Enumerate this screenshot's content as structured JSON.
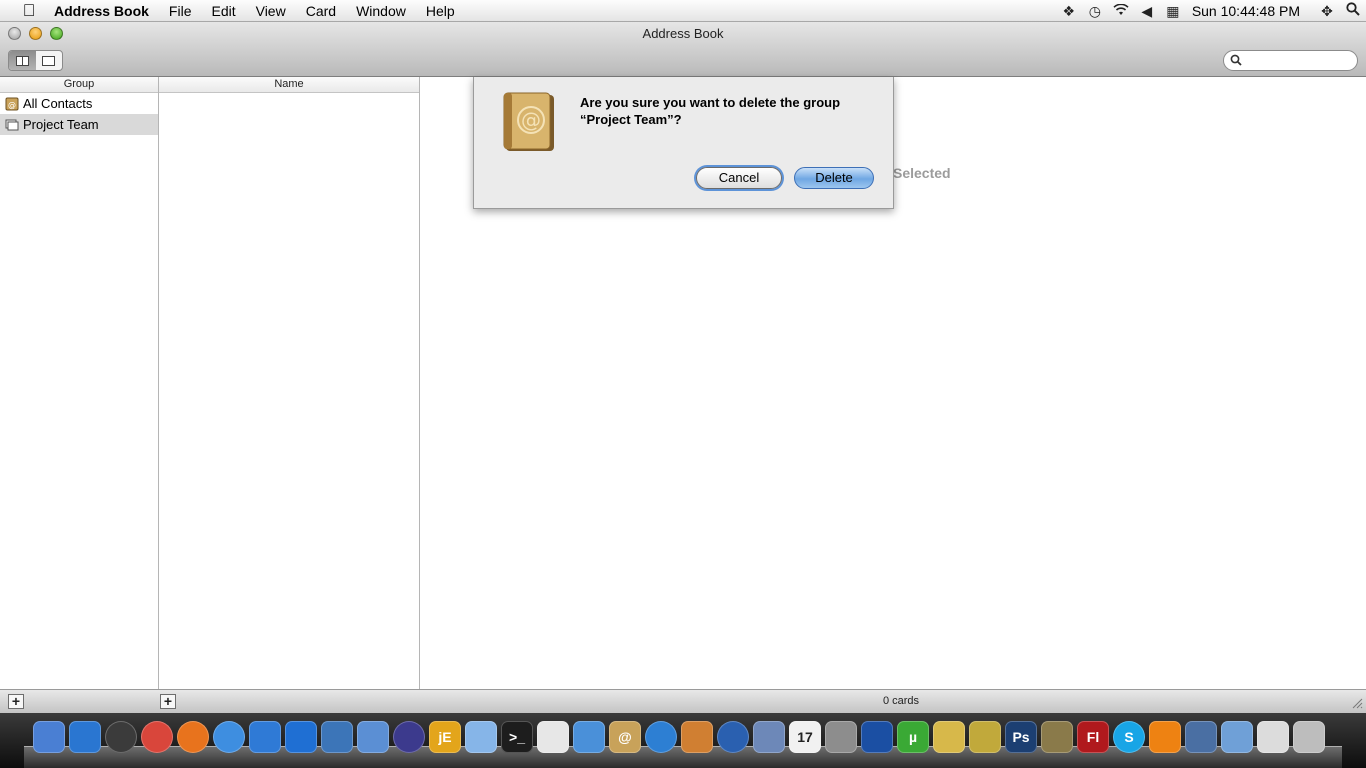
{
  "menubar": {
    "app_name": "Address Book",
    "menus": [
      "File",
      "Edit",
      "View",
      "Card",
      "Window",
      "Help"
    ],
    "clock": "Sun 10:44:48 PM"
  },
  "window": {
    "title": "Address Book"
  },
  "search": {
    "placeholder": ""
  },
  "columns": {
    "group_header": "Group",
    "name_header": "Name"
  },
  "groups": [
    {
      "label": "All Contacts",
      "selected": false
    },
    {
      "label": "Project Team",
      "selected": true
    }
  ],
  "card_area": {
    "empty_text": "Selected"
  },
  "status_bar": {
    "card_count": "0 cards"
  },
  "dialog": {
    "message_line1": "Are you sure you want to delete the group",
    "message_line2": "“Project Team”?",
    "cancel_label": "Cancel",
    "delete_label": "Delete"
  },
  "dock": {
    "items": [
      {
        "name": "finder",
        "color": "#4a7fd3"
      },
      {
        "name": "app-store",
        "color": "#2a76d1"
      },
      {
        "name": "dashboard",
        "color": "#3b3b3b"
      },
      {
        "name": "chrome",
        "color": "#d9463b"
      },
      {
        "name": "firefox",
        "color": "#e8731d"
      },
      {
        "name": "safari",
        "color": "#3e8ee0"
      },
      {
        "name": "ichat",
        "color": "#2f7ad6"
      },
      {
        "name": "internet-explorer",
        "color": "#1f6fd3"
      },
      {
        "name": "xcode",
        "color": "#3c75b8"
      },
      {
        "name": "preview",
        "color": "#5b8fd4"
      },
      {
        "name": "eclipse",
        "color": "#3c3a8d"
      },
      {
        "name": "jedit",
        "color": "#e3a51b",
        "text": "jE"
      },
      {
        "name": "mail",
        "color": "#86b5e8"
      },
      {
        "name": "terminal",
        "color": "#1d1d1d",
        "text": ">_"
      },
      {
        "name": "textedit",
        "color": "#e7e7e7"
      },
      {
        "name": "facetime",
        "color": "#4a90d9"
      },
      {
        "name": "address-book",
        "color": "#c8a25a",
        "text": "@"
      },
      {
        "name": "itunes",
        "color": "#2d7fd3"
      },
      {
        "name": "iphoto",
        "color": "#d07f32"
      },
      {
        "name": "dvd-player",
        "color": "#2a60b0"
      },
      {
        "name": "mail-stamp",
        "color": "#6d88b8"
      },
      {
        "name": "ical",
        "color": "#f1f1f1",
        "text": "17"
      },
      {
        "name": "system-preferences",
        "color": "#8d8d8d"
      },
      {
        "name": "frog-app",
        "color": "#1b4fa3"
      },
      {
        "name": "utorrent",
        "color": "#3aa935",
        "text": "µ"
      },
      {
        "name": "pencil-app",
        "color": "#d7b84a"
      },
      {
        "name": "flight-app",
        "color": "#c1a93b"
      },
      {
        "name": "photoshop",
        "color": "#1c3f72",
        "text": "Ps"
      },
      {
        "name": "paris-app",
        "color": "#8a7a4a"
      },
      {
        "name": "flash",
        "color": "#b0191d",
        "text": "Fl"
      },
      {
        "name": "skype",
        "color": "#18a5e6",
        "text": "S"
      },
      {
        "name": "vlc",
        "color": "#ee8212"
      },
      {
        "name": "photo-app",
        "color": "#4a6fa3"
      },
      {
        "name": "documents-stack",
        "color": "#6fa0d7"
      },
      {
        "name": "downloads-stack",
        "color": "#dcdcdc"
      },
      {
        "name": "trash",
        "color": "#bdbdbd"
      }
    ]
  }
}
